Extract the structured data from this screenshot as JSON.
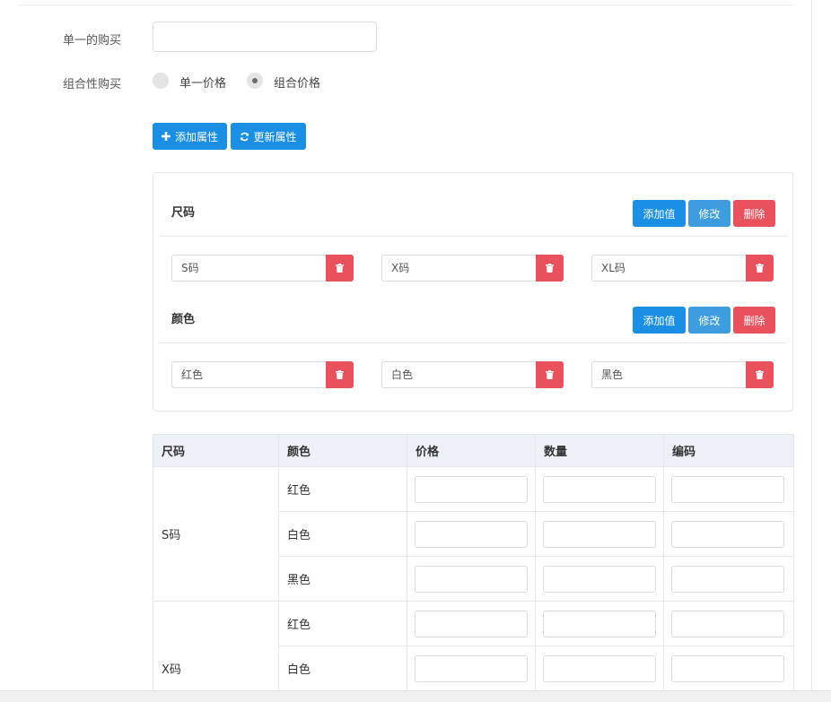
{
  "form": {
    "single_purchase_label": "单一的购买",
    "single_purchase_value": "",
    "combo_purchase_label": "组合性购买",
    "price_mode_options": [
      {
        "label": "单一价格",
        "checked": false
      },
      {
        "label": "组合价格",
        "checked": true
      }
    ]
  },
  "toolbar": {
    "add_attribute_label": "添加属性",
    "update_attribute_label": "更新属性"
  },
  "attributes": [
    {
      "name": "尺码",
      "add_value_label": "添加值",
      "edit_label": "修改",
      "delete_label": "删除",
      "values": [
        "S码",
        "X码",
        "XL码"
      ]
    },
    {
      "name": "颜色",
      "add_value_label": "添加值",
      "edit_label": "修改",
      "delete_label": "删除",
      "values": [
        "红色",
        "白色",
        "黑色"
      ]
    }
  ],
  "sku_table": {
    "headers": [
      "尺码",
      "颜色",
      "价格",
      "数量",
      "编码"
    ],
    "groups": [
      {
        "size": "S码",
        "colors": [
          "红色",
          "白色",
          "黑色"
        ]
      },
      {
        "size": "X码",
        "colors": [
          "红色",
          "白色"
        ]
      }
    ]
  },
  "colors": {
    "primary": "#1a8fe3",
    "edit": "#3d9ddf",
    "danger": "#e9515d",
    "table_header_bg": "#ebf1f6"
  },
  "icons": {
    "add": "plus-icon",
    "refresh": "refresh-icon",
    "delete": "trash-icon"
  }
}
